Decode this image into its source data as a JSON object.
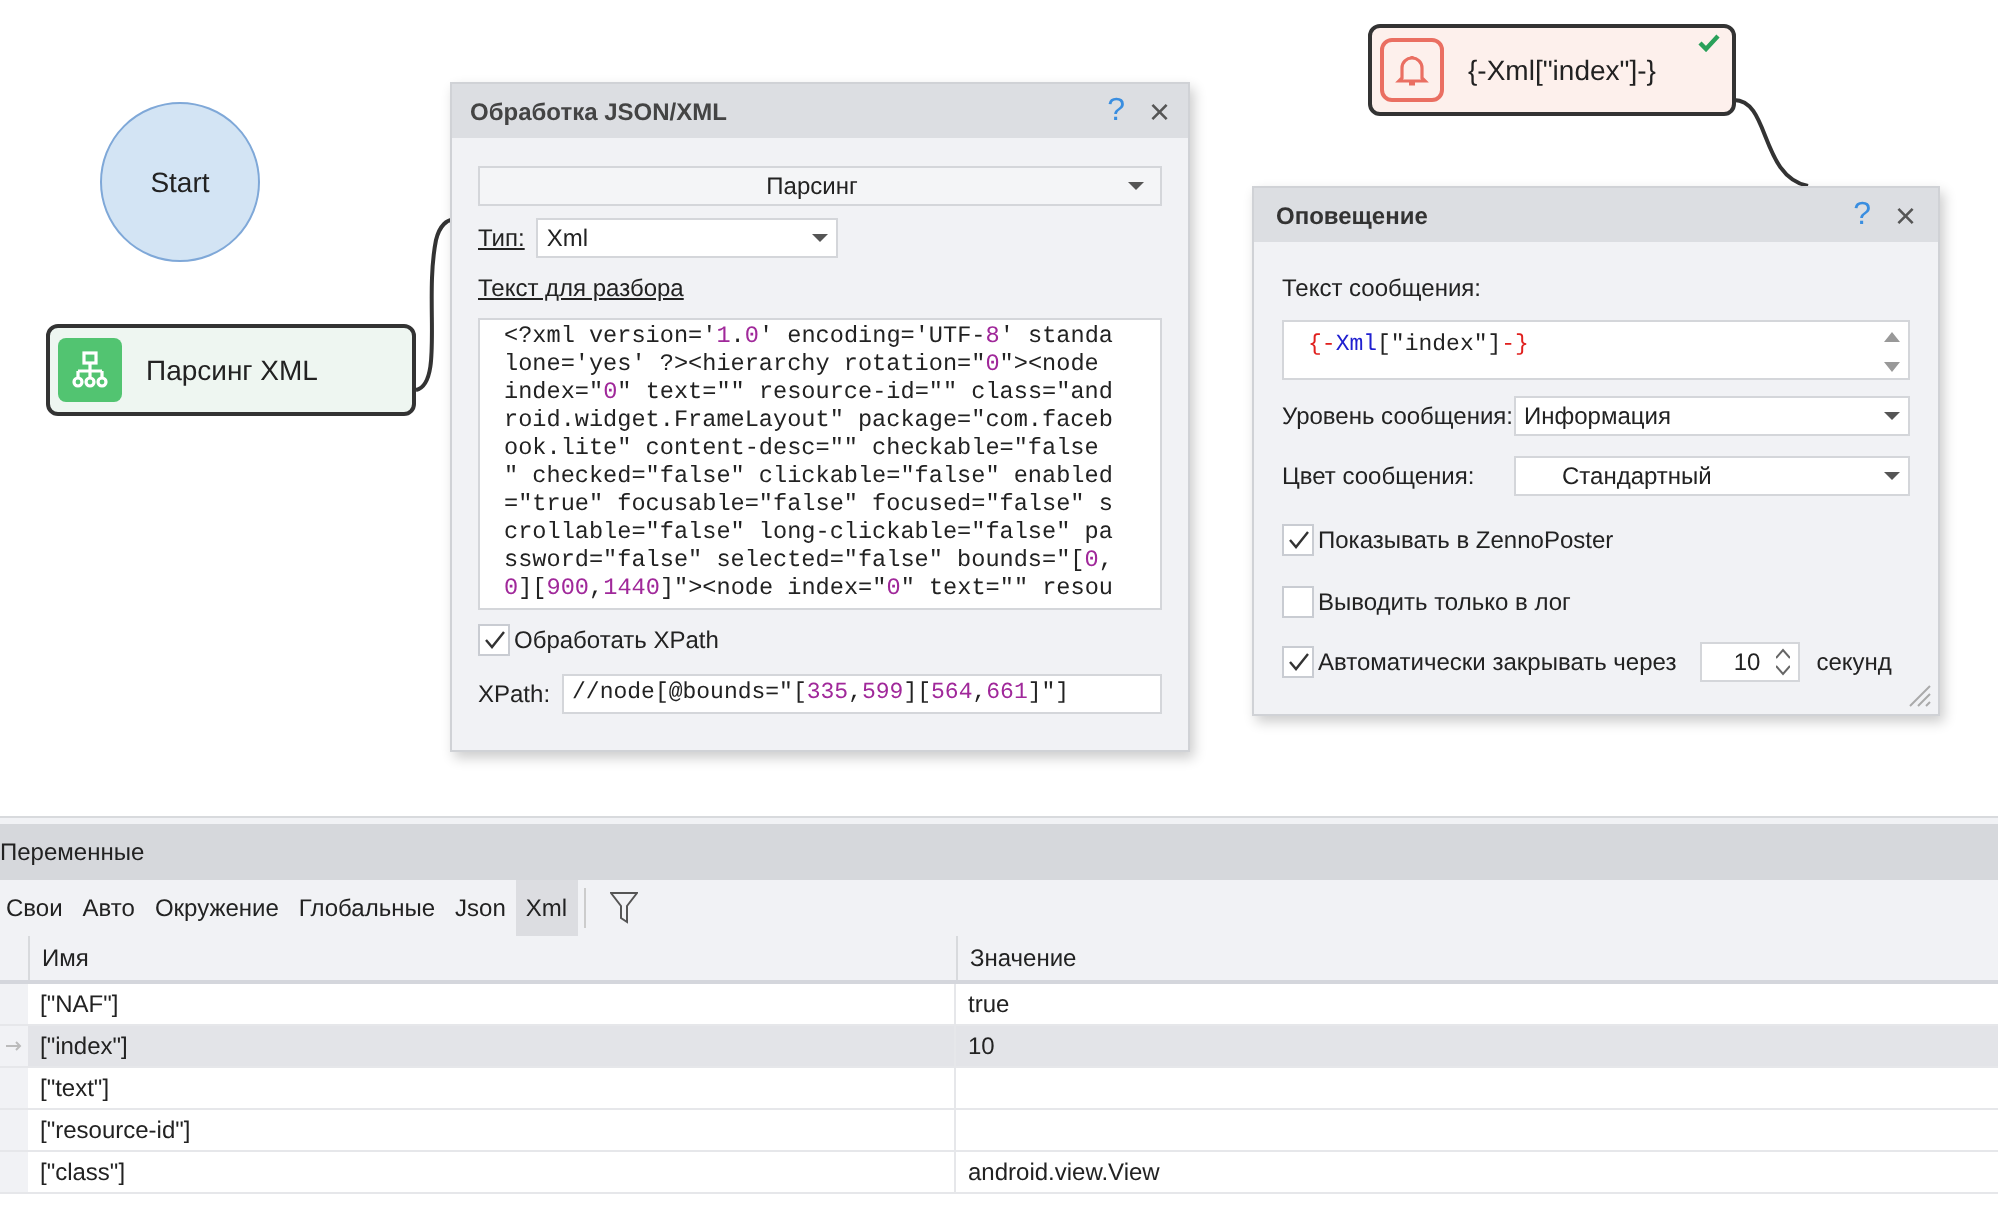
{
  "canvas": {
    "start_node": {
      "label": "Start"
    },
    "parse_node": {
      "label": "Парсинг XML"
    },
    "notify_node": {
      "label": "{-Xml[\"index\"]-}",
      "ok": true
    }
  },
  "json_dialog": {
    "title": "Обработка JSON/XML",
    "help": "?",
    "close": "×",
    "action": "Парсинг",
    "type_label": "Тип:",
    "type_value": "Xml",
    "text_label": "Текст для разбора",
    "text_lines": [
      "<?xml version='1.0' encoding='UTF-8' standa",
      "lone='yes' ?><hierarchy rotation=\"0\"><node",
      "index=\"0\" text=\"\" resource-id=\"\" class=\"and",
      "roid.widget.FrameLayout\" package=\"com.faceb",
      "ook.lite\" content-desc=\"\" checkable=\"false",
      "\" checked=\"false\" clickable=\"false\" enabled",
      "=\"true\" focusable=\"false\" focused=\"false\" s",
      "crollable=\"false\" long-clickable=\"false\" pa",
      "ssword=\"false\" selected=\"false\" bounds=\"[0,",
      "0][900,1440]\"><node index=\"0\" text=\"\" resou"
    ],
    "xpath_checkbox": {
      "label": "Обработать XPath",
      "checked": true
    },
    "xpath_label": "XPath:",
    "xpath_value": "//node[@bounds=\"[335,599][564,661]\"]"
  },
  "notify_dialog": {
    "title": "Оповещение",
    "help": "?",
    "close": "×",
    "message_label": "Текст сообщения:",
    "message_value": "{-Xml[\"index\"]-}",
    "level_label": "Уровень сообщения:",
    "level_value": "Информация",
    "color_label": "Цвет сообщения:",
    "color_value": "Стандартный",
    "checkboxes": [
      {
        "label": "Показывать в ZennoPoster",
        "checked": true
      },
      {
        "label": "Выводить только в лог",
        "checked": false
      }
    ],
    "autoclose": {
      "label": "Автоматически закрывать через",
      "checked": true,
      "value": "10",
      "unit": "секунд"
    }
  },
  "variables": {
    "title": "Переменные",
    "tabs": [
      {
        "label": "Свои",
        "selected": false
      },
      {
        "label": "Авто",
        "selected": false
      },
      {
        "label": "Окружение",
        "selected": false
      },
      {
        "label": "Глобальные",
        "selected": false
      },
      {
        "label": "Json",
        "selected": false
      },
      {
        "label": "Xml",
        "selected": true
      }
    ],
    "columns": [
      "Имя",
      "Значение"
    ],
    "rows": [
      {
        "name": "[\"NAF\"]",
        "value": "true",
        "selected": false
      },
      {
        "name": "[\"index\"]",
        "value": "10",
        "selected": true
      },
      {
        "name": "[\"text\"]",
        "value": "",
        "selected": false
      },
      {
        "name": "[\"resource-id\"]",
        "value": "",
        "selected": false
      },
      {
        "name": "[\"class\"]",
        "value": "android.view.View",
        "selected": false
      }
    ]
  }
}
